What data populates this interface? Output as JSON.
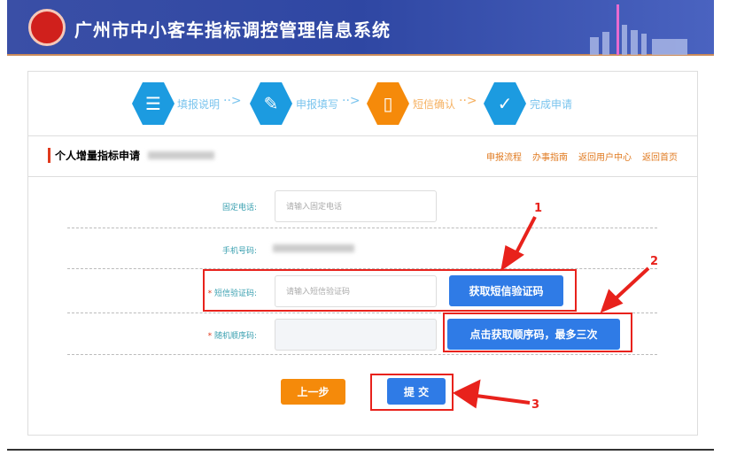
{
  "header": {
    "title": "广州市中小客车指标调控管理信息系统"
  },
  "steps": [
    {
      "label": "填报说明",
      "icon": "document-list-icon",
      "state": "done"
    },
    {
      "label": "申报填写",
      "icon": "edit-document-icon",
      "state": "done"
    },
    {
      "label": "短信确认",
      "icon": "phone-message-icon",
      "state": "active"
    },
    {
      "label": "完成申请",
      "icon": "check-document-icon",
      "state": "pending"
    }
  ],
  "section": {
    "title": "个人增量指标申请",
    "links": [
      "申报流程",
      "办事指南",
      "返回用户中心",
      "返回首页"
    ]
  },
  "form": {
    "landline_label": "固定电话:",
    "landline_placeholder": "请输入固定电话",
    "mobile_label": "手机号码:",
    "sms_label": "短信验证码:",
    "sms_placeholder": "请输入短信验证码",
    "sms_button": "获取短信验证码",
    "random_label": "随机顺序码:",
    "random_button": "点击获取顺序码，最多三次",
    "required_mark": "*",
    "prev_button": "上一步",
    "submit_button": "提 交"
  },
  "annotations": [
    "1",
    "2",
    "3"
  ],
  "colors": {
    "accent": "#2f7be6",
    "orange": "#f58a0a",
    "annotation": "#e8221c"
  }
}
